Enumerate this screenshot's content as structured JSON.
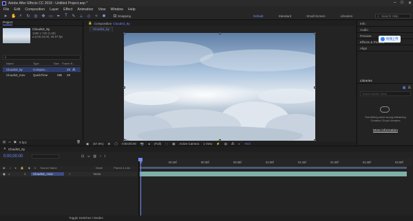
{
  "app": {
    "title": "Adobe After Effects CC 2018 - Untitled Project.aep *"
  },
  "menu": [
    "File",
    "Edit",
    "Composition",
    "Layer",
    "Effect",
    "Animation",
    "View",
    "Window",
    "Help"
  ],
  "toolbar": {
    "snapping_label": "Snapping",
    "workspaces": [
      "Default",
      "Standard",
      "Small Screen",
      "Libraries"
    ],
    "search_placeholder": "Search Help"
  },
  "project": {
    "tab": "Project",
    "selected_name": "Clouds3_6y",
    "info_line1": "1280 x 720 (1.00)",
    "info_line2": "Δ 0;00;10;00, 29.97 fps",
    "columns": [
      "Name",
      "Type",
      "Size",
      "Frame R..."
    ],
    "rows": [
      {
        "name": "Clouds3_6y",
        "type": "Compos...",
        "size": "",
        "frame_rate": "29"
      },
      {
        "name": "Clouds3_mov",
        "type": "QuickTime",
        "size": "MB",
        "frame_rate": "29"
      }
    ],
    "bpc": "8 bpc"
  },
  "composition": {
    "tab_prefix": "Composition",
    "tab_name": "Clouds3_6y",
    "subtab": "Clouds3_6y",
    "zoom": "(57.9%)",
    "timecode": "0;00;00;00",
    "resolution": "(Full)",
    "camera": "Active Camera",
    "views": "1 View",
    "exposure": "+0.0"
  },
  "right_panel": {
    "panels": [
      "Info",
      "Audio",
      "Preview",
      "Effects & Presets",
      "Align"
    ],
    "libraries_title": "Libraries",
    "lib_search_placeholder": "Search Adobe Stock",
    "message_line1": "Something went wrong initializing",
    "message_line2": "Creative Cloud Libraries",
    "more_info": "More information",
    "tooltip": "拖拽上传"
  },
  "timeline": {
    "tab": "Clouds3_6y",
    "timecode": "0;00;00;00",
    "columns": [
      "#",
      "Source Name",
      "Mode",
      "Parent & Link"
    ],
    "layer": {
      "number": "1",
      "name": "Clouds3_.mov",
      "mode": "None"
    },
    "ruler": [
      "0f",
      "00:15f",
      "00:30f",
      "00:45f",
      "01:00f",
      "01:15f",
      "01:30f",
      "01:45f",
      "02:00f"
    ],
    "footer": "Toggle Switches / Modes"
  },
  "colors": {
    "accent": "#6f8cff",
    "layer_bar": "#7fb0a8",
    "selected_row": "#2e3c6c"
  }
}
